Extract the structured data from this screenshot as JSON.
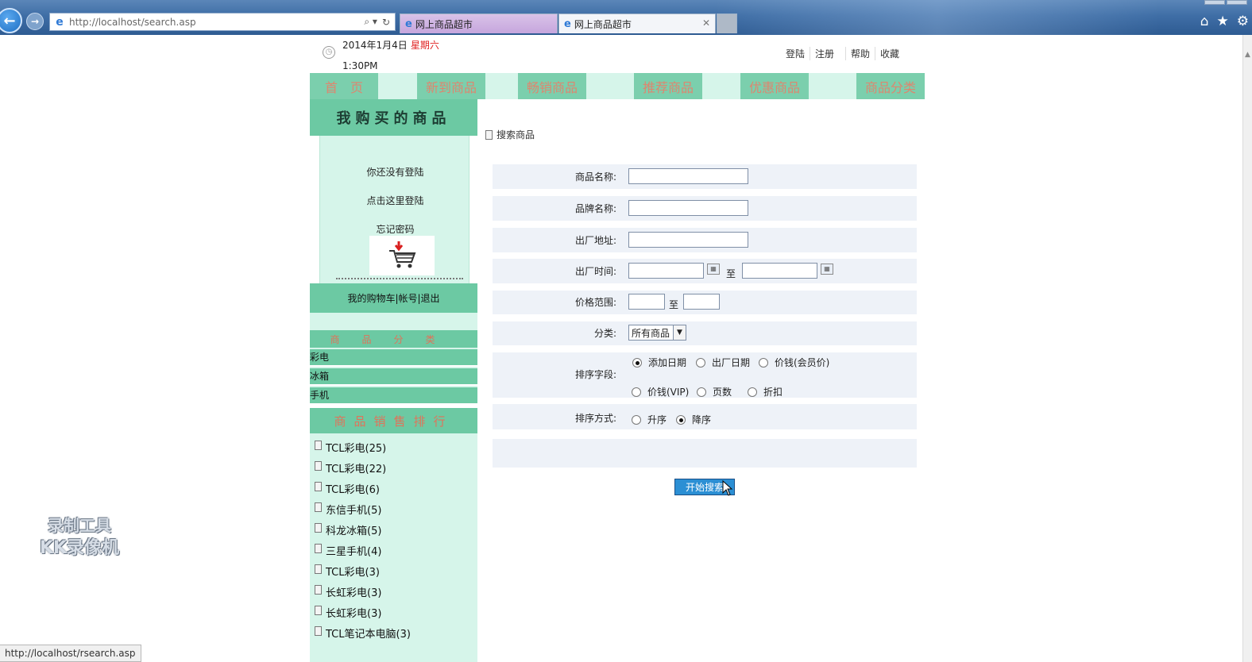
{
  "browser": {
    "address": "http://localhost/search.asp",
    "tabs": [
      {
        "title": "网上商品超市"
      },
      {
        "title": "网上商品超市"
      }
    ],
    "status_url": "http://localhost/rsearch.asp"
  },
  "header": {
    "date": "2014年1月4日",
    "weekday": "星期六",
    "time": "1:30PM",
    "links": [
      "登陆",
      "注册",
      "帮助",
      "收藏"
    ]
  },
  "nav": {
    "items": [
      "首　页",
      "新到商品",
      "畅销商品",
      "推荐商品",
      "优惠商品",
      "商品分类"
    ]
  },
  "sidebar": {
    "my_purchases_title": "我购买的商品",
    "not_logged_in": "你还没有登陆",
    "click_login": "点击这里登陆",
    "forgot_password": "忘记密码",
    "account_links": "我的购物车|帐号|退出",
    "category_header": "商品分类",
    "categories": [
      "彩电",
      "冰箱",
      "手机"
    ],
    "ranking_header": "商品销售排行",
    "ranking": [
      "TCL彩电(25)",
      "TCL彩电(22)",
      "TCL彩电(6)",
      "东信手机(5)",
      "科龙冰箱(5)",
      "三星手机(4)",
      "TCL彩电(3)",
      "长虹彩电(3)",
      "长虹彩电(3)",
      "TCL笔记本电脑(3)"
    ]
  },
  "search": {
    "title": "搜索商品",
    "labels": {
      "name": "商品名称:",
      "brand": "品牌名称:",
      "address": "出厂地址:",
      "date": "出厂时间:",
      "price": "价格范围:",
      "category": "分类:",
      "sort_field": "排序字段:",
      "sort_order": "排序方式:"
    },
    "to": "至",
    "category_value": "所有商品",
    "sort_fields": [
      "添加日期",
      "出厂日期",
      "价钱(会员价)",
      "价钱(VIP)",
      "页数",
      "折扣"
    ],
    "sort_field_selected": "添加日期",
    "sort_orders": [
      "升序",
      "降序"
    ],
    "sort_order_selected": "降序",
    "submit": "开始搜索"
  },
  "overlay": {
    "watermark_line1": "录制工具",
    "watermark_line2": "KK录像机"
  }
}
